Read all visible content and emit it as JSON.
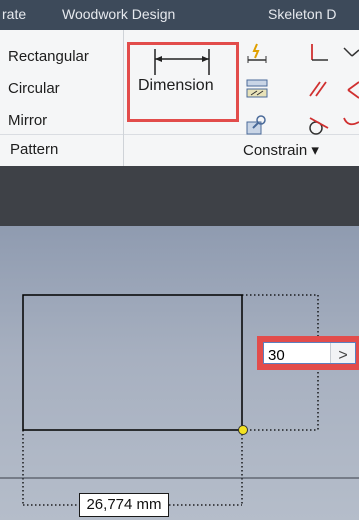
{
  "ribbon_tabs": [
    "rate",
    "Woodwork Design",
    "Skeleton D"
  ],
  "pattern_panel": {
    "items": [
      "Rectangular",
      "Circular",
      "Mirror"
    ],
    "panel_label": "Pattern"
  },
  "constrain_panel": {
    "dimension_label": "Dimension",
    "panel_label": "Constrain ▾"
  },
  "sketch": {
    "input_value": "30",
    "input_arrow": ">",
    "dimension_readout": "26,774 mm"
  },
  "colors": {
    "highlight": "#e24c4b",
    "tabbar": "#3d4a5a",
    "canvas_top": "#8f9bb0",
    "canvas_bottom": "#b5bdca",
    "point": "#f3e222"
  }
}
